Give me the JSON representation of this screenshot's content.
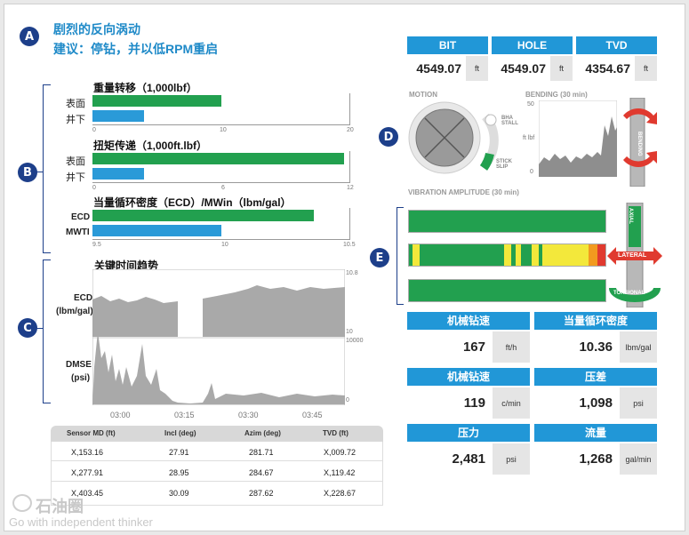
{
  "header": {
    "badge": "A",
    "line1": "剧烈的反向涡动",
    "line2": "建议：停钻，并以低RPM重启"
  },
  "section_b": {
    "badge": "B",
    "weight": {
      "title": "重量转移（1,000lbf）",
      "labels": [
        "表面",
        "井下"
      ],
      "ticks": [
        "0",
        "10",
        "20"
      ],
      "values": [
        10,
        4
      ],
      "max": 20
    },
    "torque": {
      "title": "扭矩传递（1,000ft.lbf）",
      "labels": [
        "表面",
        "井下"
      ],
      "ticks": [
        "0",
        "6",
        "12"
      ],
      "values": [
        11.7,
        2.4
      ],
      "max": 12
    },
    "ecd": {
      "title": "当量循环密度（ECD）/MWin（lbm/gal）",
      "labels": [
        "ECD",
        "MWTI"
      ],
      "ticks": [
        "9.5",
        "10",
        "10.5"
      ],
      "values": [
        10.36,
        10.0
      ],
      "min": 9.5,
      "max": 10.5
    }
  },
  "section_c": {
    "badge": "C",
    "title": "关键时间趋势",
    "ecd_label_1": "ECD",
    "ecd_label_2": "(lbm/gal)",
    "dmse_label_1": "DMSE",
    "dmse_label_2": "(psi)",
    "ecd_ticks": [
      "10.8",
      "10"
    ],
    "dmse_ticks": [
      "10000",
      "0"
    ],
    "time_ticks": [
      "03:00",
      "03:15",
      "03:30",
      "03:45"
    ]
  },
  "sensor_table": {
    "headers": [
      "Sensor MD (ft)",
      "Incl (deg)",
      "Azim (deg)",
      "TVD (ft)"
    ],
    "rows": [
      [
        "X,153.16",
        "27.91",
        "281.71",
        "X,009.72"
      ],
      [
        "X,277.91",
        "28.95",
        "284.67",
        "X,119.42"
      ],
      [
        "X,403.45",
        "30.09",
        "287.62",
        "X,228.67"
      ]
    ]
  },
  "depths": [
    {
      "label": "BIT",
      "value": "4549.07",
      "unit": "ft"
    },
    {
      "label": "HOLE",
      "value": "4549.07",
      "unit": "ft"
    },
    {
      "label": "TVD",
      "value": "4354.67",
      "unit": "ft"
    }
  ],
  "motion": {
    "label": "MOTION",
    "badge": "D",
    "gauge_top": "BHA STALL",
    "gauge_bottom": "STICK SLIP"
  },
  "bending": {
    "label": "BENDING (30 min)",
    "ticks": [
      "50",
      "ft lbf",
      "0"
    ],
    "pipe_text": "BENDING"
  },
  "vibration": {
    "label": "VIBRATION AMPLITUDE (30 min)",
    "badge": "E",
    "axial": "AXIAL",
    "lateral": "LATERAL",
    "torsional": "TORSIONAL"
  },
  "metrics": [
    {
      "label": "机械钻速",
      "value": "167",
      "unit": "ft/h"
    },
    {
      "label": "当量循环密度",
      "value": "10.36",
      "unit": "lbm/gal"
    },
    {
      "label": "机械钻速",
      "value": "119",
      "unit": "c/min"
    },
    {
      "label": "压差",
      "value": "1,098",
      "unit": "psi"
    },
    {
      "label": "压力",
      "value": "2,481",
      "unit": "psi"
    },
    {
      "label": "流量",
      "value": "1,268",
      "unit": "gal/min"
    }
  ],
  "watermark": {
    "logo_text": "石油圈",
    "tagline": "Go with independent thinker"
  },
  "colors": {
    "green": "#22a04f",
    "blue": "#2a9ad8",
    "navy": "#1d3f8a",
    "red": "#e03a2f",
    "yellow": "#f3e83b",
    "orange": "#f29a1f"
  }
}
